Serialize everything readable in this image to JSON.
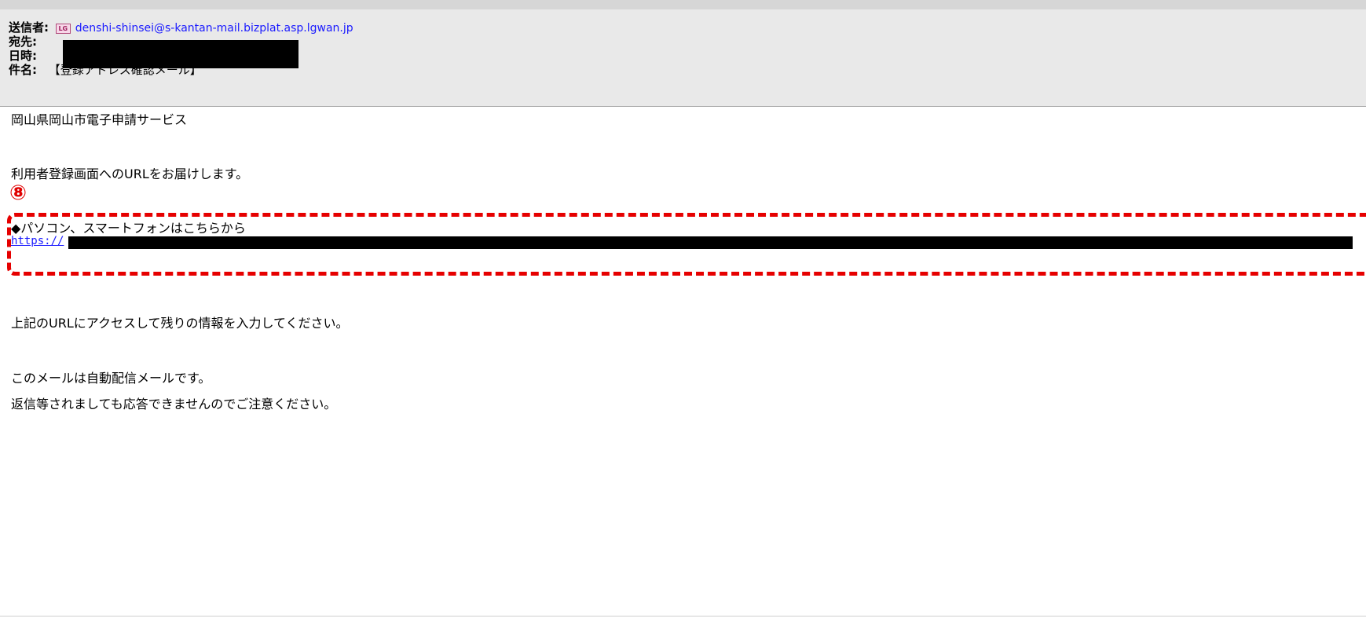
{
  "header": {
    "sender_label": "送信者",
    "sender_badge": "LG",
    "sender_email": "denshi-shinsei@s-kantan-mail.bizplat.asp.lgwan.jp",
    "to_label": "宛先",
    "date_label": "日時",
    "subject_label": "件名",
    "subject": "【登録アドレス確認メール】"
  },
  "body": {
    "service_name": "岡山県岡山市電子申請サービス",
    "intro": "利用者登録画面へのURLをお届けします。",
    "marker": "⑧",
    "pc_heading": "◆パソコン、スマートフォンはこちらから",
    "link_visible": "https://",
    "instruction": "上記のURLにアクセスして残りの情報を入力してください。",
    "notice1": "このメールは自動配信メールです。",
    "notice2": "返信等されましても応答できませんのでご注意ください。"
  },
  "colors": {
    "header_bg": "#e9e9e9",
    "link": "#1a1aff",
    "annotation": "#e60000"
  }
}
